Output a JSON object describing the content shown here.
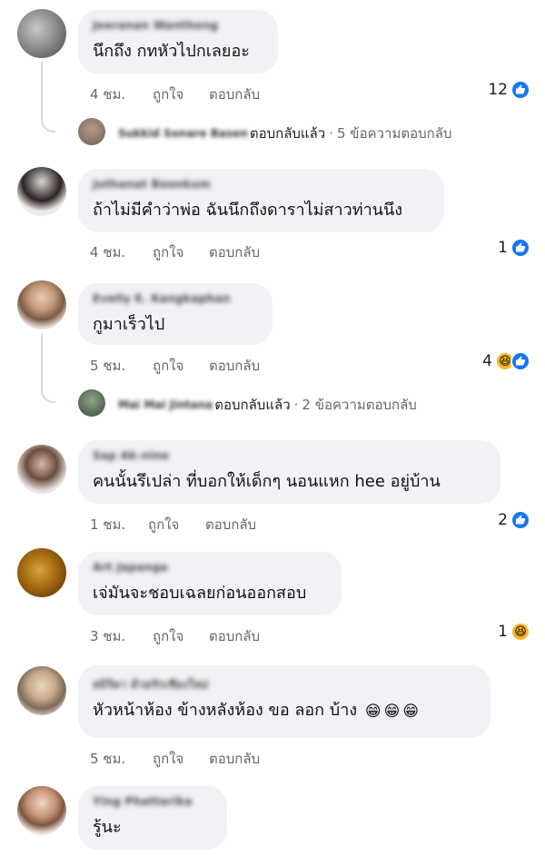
{
  "ui": {
    "like_label": "ถูกใจ",
    "reply_label": "ตอบกลับ",
    "replied_label": "ตอบกลับแล้ว",
    "thumbs_glyph": "👍",
    "haha_glyph": "😆"
  },
  "comments": [
    {
      "author": "Jeeranan Wanthong",
      "text": "นึกถึง กทหัวไปกเลยอะ",
      "time": "4 ชม.",
      "reaction_count": "12",
      "reactions": [
        "like-icon"
      ],
      "reply_summary": {
        "author": "Sukkid Sonare Basen",
        "count_text": "5 ข้อความตอบกลับ"
      }
    },
    {
      "author": "Juthanat Boonkum",
      "text": "ถ้าไม่มีคำว่าพ่อ ฉันนึกถึงดาราไม่สาวท่านนึง",
      "time": "4 ชม.",
      "reaction_count": "1",
      "reactions": [
        "like-icon"
      ]
    },
    {
      "author": "Evelly E. Kangkaphan",
      "text": "กูมาเร็วไป",
      "time": "5 ชม.",
      "reaction_count": "4",
      "reactions": [
        "haha-icon",
        "like-icon"
      ],
      "reply_summary": {
        "author": "Mai Mai Jintana",
        "count_text": "2 ข้อความตอบกลับ"
      }
    },
    {
      "author": "Sap Ak-nine",
      "text": "คนนั้นรึเปล่า  ที่บอกให้เด็กๆ นอนแหก hee  อยู่บ้าน",
      "time": "1 ชม.",
      "reaction_count": "2",
      "reactions": [
        "like-icon"
      ]
    },
    {
      "author": "Art Japanga",
      "text": "เจ่มันจะชอบเฉลยก่อนออกสอบ",
      "time": "3 ชม.",
      "reaction_count": "1",
      "reactions": [
        "haha-icon"
      ]
    },
    {
      "author": "สมิริดา ด้วยรักเชียงใหม่",
      "text": "หัวหน้าห้อง   ข้างหลังห้อง  ขอ ลอก บ้าง",
      "emojis": [
        "😁",
        "😁",
        "😁"
      ],
      "time": "5 ชม."
    },
    {
      "author": "Ying Phattarika",
      "text": "รู้นะ"
    }
  ],
  "colors": {
    "bubble_bg": "#f0f2f5",
    "like_blue": "#1877f2",
    "haha_yellow": "#f7b928",
    "meta_gray": "#65676b"
  }
}
